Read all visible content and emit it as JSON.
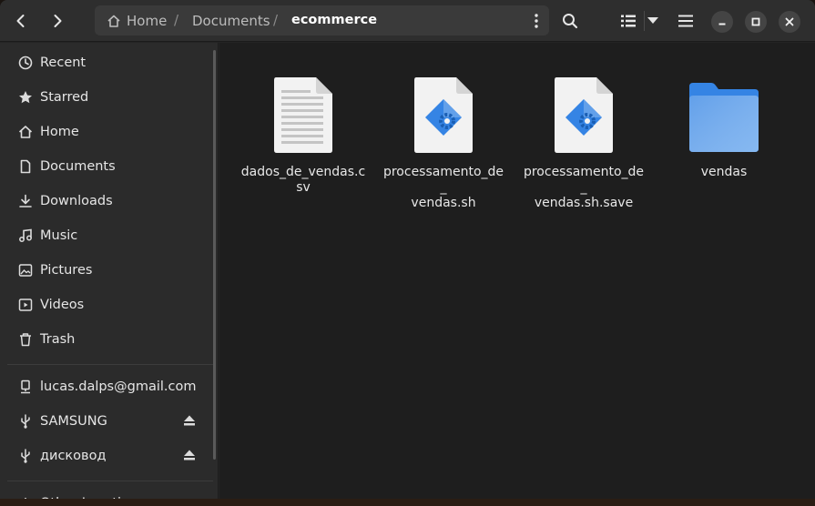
{
  "header": {
    "path": {
      "home": "Home",
      "documents": "Documents",
      "current": "ecommerce",
      "separator": "/"
    },
    "icons": [
      "back-icon",
      "forward-icon",
      "search-icon",
      "list-view-icon",
      "view-options-icon",
      "menu-icon",
      "minimize-icon",
      "maximize-icon",
      "close-icon"
    ]
  },
  "sidebar": {
    "places": [
      {
        "label": "Recent",
        "icon": "clock-icon"
      },
      {
        "label": "Starred",
        "icon": "star-icon"
      },
      {
        "label": "Home",
        "icon": "home-icon"
      },
      {
        "label": "Documents",
        "icon": "document-icon"
      },
      {
        "label": "Downloads",
        "icon": "download-icon"
      },
      {
        "label": "Music",
        "icon": "music-icon"
      },
      {
        "label": "Pictures",
        "icon": "picture-icon"
      },
      {
        "label": "Videos",
        "icon": "video-icon"
      },
      {
        "label": "Trash",
        "icon": "trash-icon"
      }
    ],
    "devices": [
      {
        "label": "lucas.dalps@gmail.com",
        "icon": "online-account-icon"
      },
      {
        "label": "SAMSUNG",
        "icon": "usb-icon",
        "eject": true
      },
      {
        "label": "дисковод",
        "icon": "usb-icon",
        "eject": true
      }
    ],
    "other": {
      "label": "Other Locations"
    }
  },
  "files": [
    {
      "name": "dados_de_vendas.csv",
      "name_lines": [
        "dados_de_vendas.c",
        "sv"
      ],
      "type": "text-file-icon"
    },
    {
      "name": "processamento_de_vendas.sh",
      "name_lines": [
        "processamento_de_",
        "vendas.sh"
      ],
      "type": "script-file-icon"
    },
    {
      "name": "processamento_de_vendas.sh.save",
      "name_lines": [
        "processamento_de_",
        "vendas.sh.save"
      ],
      "type": "script-file-icon"
    },
    {
      "name": "vendas",
      "name_lines": [
        "vendas"
      ],
      "type": "folder-icon"
    }
  ],
  "colors": {
    "folder": "#62a0ea",
    "folder_back": "#3584e4",
    "script_blue": "#3584e4",
    "background": "#1e1e1e",
    "sidebar": "#2b2b2b"
  }
}
